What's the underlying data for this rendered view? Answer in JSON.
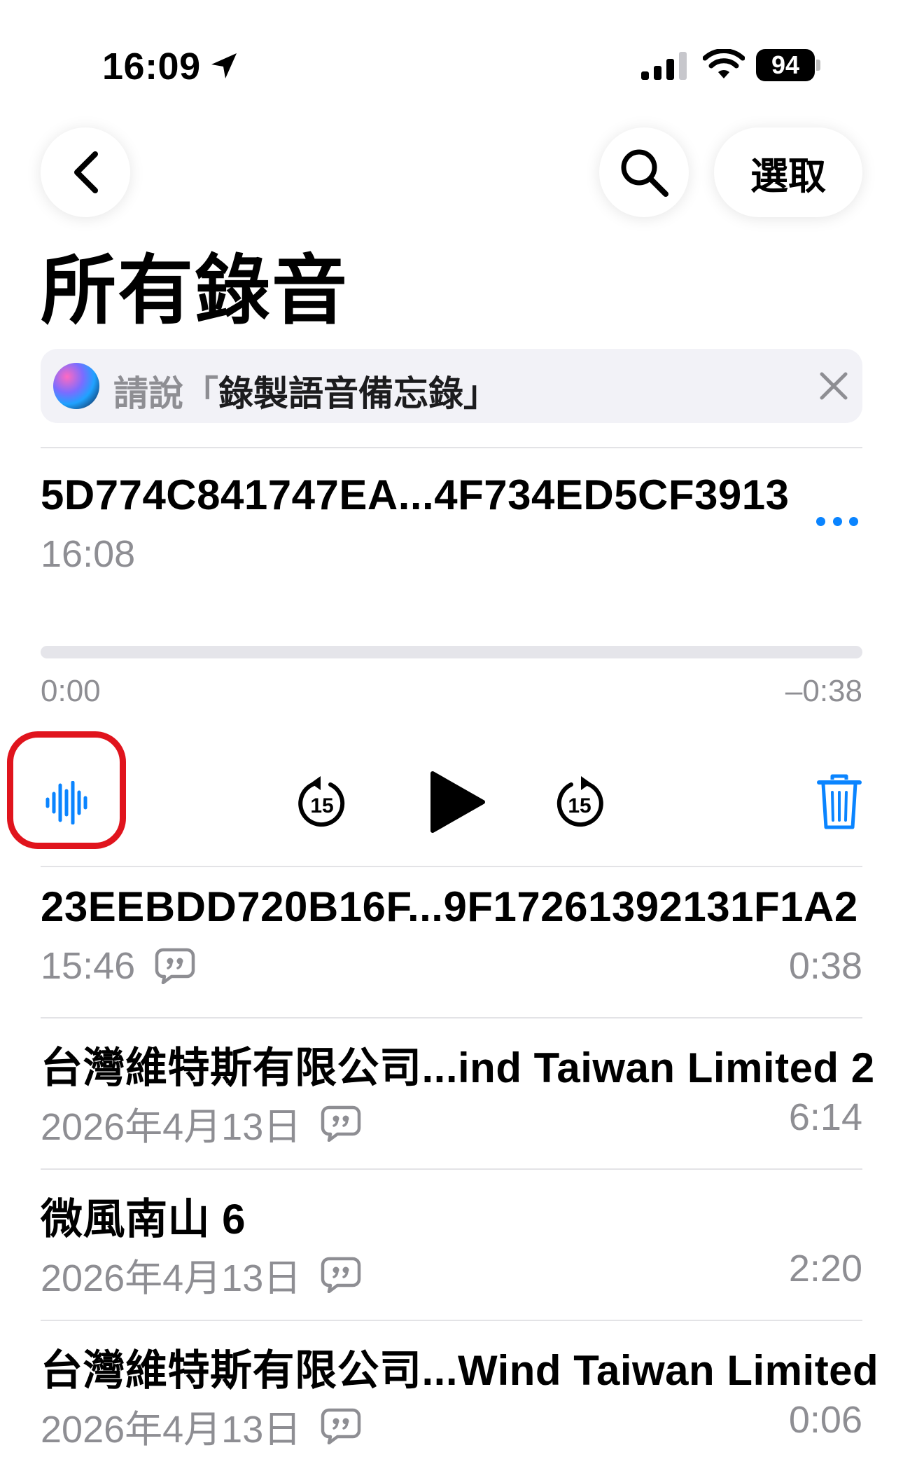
{
  "status_bar": {
    "time": "16:09",
    "battery": "94"
  },
  "nav": {
    "select_label": "選取"
  },
  "page_title": "所有錄音",
  "siri_tip": {
    "prefix": "請說「",
    "phrase": "錄製語音備忘錄",
    "suffix": "」"
  },
  "expanded_recording": {
    "title": "5D774C841747EA...4F734ED5CF3913",
    "time": "16:08",
    "elapsed": "0:00",
    "remaining": "–0:38",
    "progress": 0,
    "skip_back_seconds": "15",
    "skip_forward_seconds": "15"
  },
  "recordings": [
    {
      "title": "23EEBDD720B16F...9F17261392131F1A2",
      "date": "15:46",
      "duration": "0:38"
    },
    {
      "title": "台灣維特斯有限公司...ind Taiwan Limited 2",
      "date": "2026年4月13日",
      "duration": "6:14"
    },
    {
      "title": "微風南山 6",
      "date": "2026年4月13日",
      "duration": "2:20"
    },
    {
      "title": "台灣維特斯有限公司...Wind Taiwan Limited",
      "date": "2026年4月13日",
      "duration": "0:06"
    }
  ],
  "colors": {
    "accent": "#0a84ff",
    "secondary_text": "#8e8e93",
    "highlight": "#e0141d"
  },
  "icons": {
    "back": "chevron-left-icon",
    "search": "magnifying-glass-icon",
    "waveform": "waveform-icon",
    "skip_back": "gobackward-15-icon",
    "play": "play-icon",
    "skip_forward": "goforward-15-icon",
    "trash": "trash-icon",
    "transcript": "quote-bubble-icon"
  }
}
